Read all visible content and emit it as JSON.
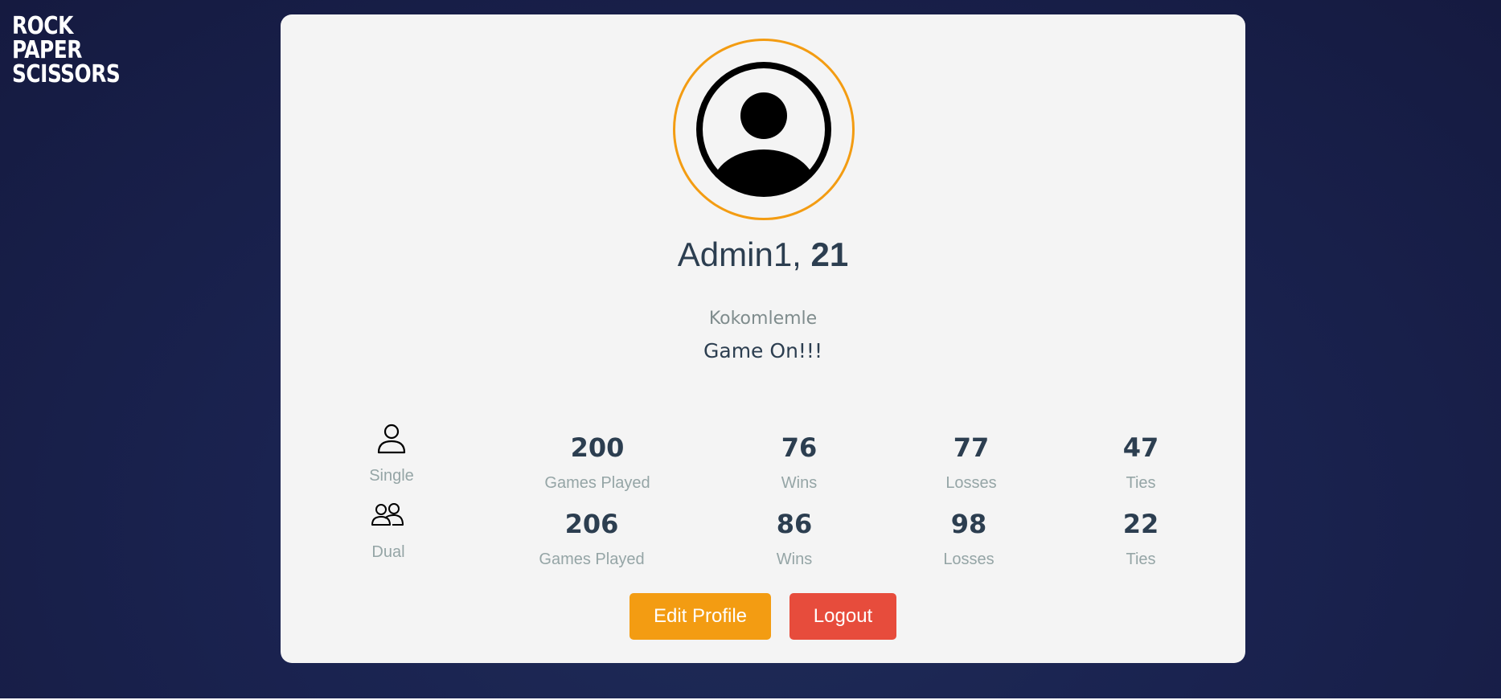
{
  "app": {
    "logo_lines": [
      "ROCK",
      "PAPER",
      "SCISSORS"
    ]
  },
  "profile": {
    "name": "Admin1",
    "separator": ", ",
    "age": "21",
    "username": "Kokomlemle",
    "status": "Game On!!!",
    "avatar_icon": "user-circle-icon",
    "avatar_ring_color": "#f39c12"
  },
  "stats": {
    "single": {
      "mode_label": "Single",
      "icon": "person-icon",
      "games_played": "200",
      "games_played_label": "Games Played",
      "wins": "76",
      "wins_label": "Wins",
      "losses": "77",
      "losses_label": "Losses",
      "ties": "47",
      "ties_label": "Ties"
    },
    "dual": {
      "mode_label": "Dual",
      "icon": "people-icon",
      "games_played": "206",
      "games_played_label": "Games Played",
      "wins": "86",
      "wins_label": "Wins",
      "losses": "98",
      "losses_label": "Losses",
      "ties": "22",
      "ties_label": "Ties"
    }
  },
  "actions": {
    "edit_label": "Edit Profile",
    "logout_label": "Logout",
    "edit_color": "#f39c12",
    "logout_color": "#e74c3c"
  },
  "colors": {
    "text_primary": "#2c3e50",
    "text_muted": "#95a5a6",
    "background": "#1a2350",
    "card": "#f4f4f4"
  }
}
